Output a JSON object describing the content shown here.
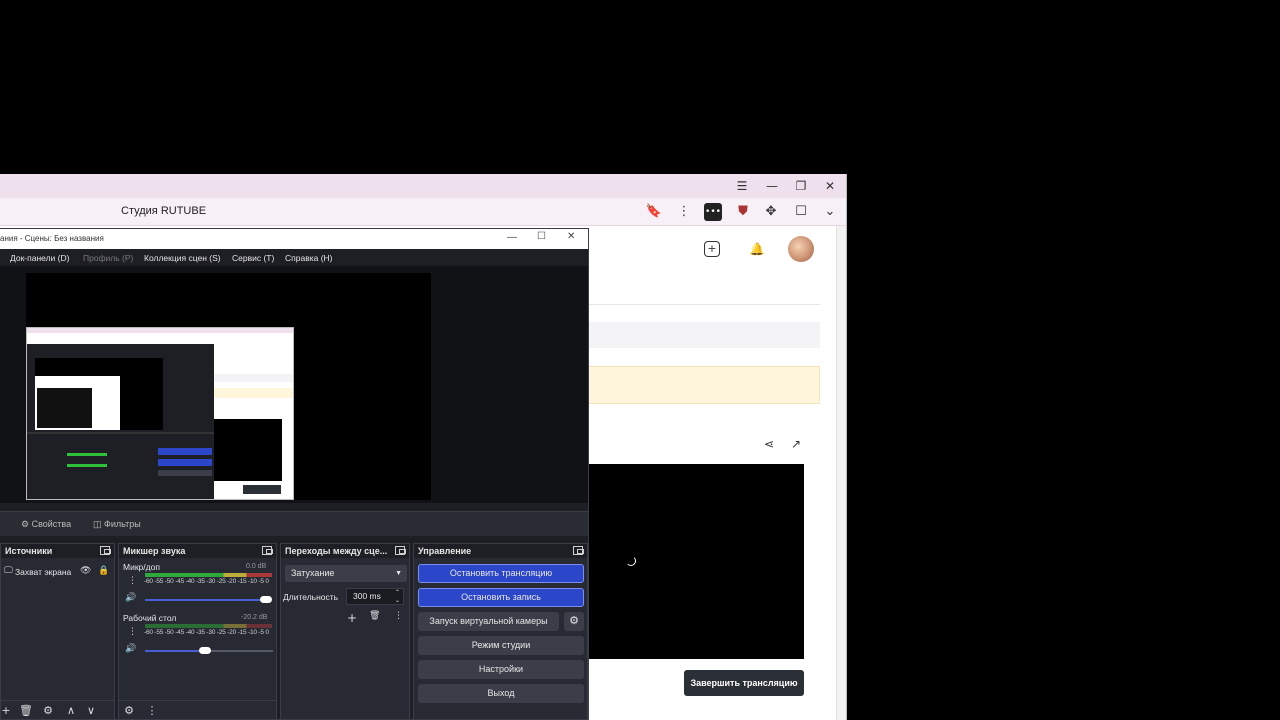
{
  "browser": {
    "title": "Студия RUTUBE",
    "controls": {
      "menu": "☰",
      "minimize": "—",
      "restore": "❐",
      "close": "✕"
    },
    "toolbar_icons": [
      "bookmark-icon",
      "more-vert-icon",
      "extension-dots-icon",
      "shield-icon",
      "puzzle-icon",
      "panel-icon",
      "chevron-down-icon"
    ]
  },
  "rutube": {
    "header_icons": [
      "add-video-icon",
      "bell-icon"
    ],
    "end_stream_label": "Завершить трансляцию",
    "accent_warn": "#fff6db"
  },
  "obs": {
    "title": "ания - Сцены: Без названия",
    "menu": [
      {
        "label": "Док-панели (D)",
        "disabled": false
      },
      {
        "label": "Профиль (P)",
        "disabled": true
      },
      {
        "label": "Коллекция сцен (S)",
        "disabled": false
      },
      {
        "label": "Сервис (T)",
        "disabled": false
      },
      {
        "label": "Справка (H)",
        "disabled": false
      }
    ],
    "props_label": "Свойства",
    "filters_label": "Фильтры",
    "sources": {
      "title": "Источники",
      "items": [
        {
          "label": "Захват экрана"
        }
      ]
    },
    "mixer": {
      "title": "Микшер звука",
      "channels": [
        {
          "name": "Микр/доп",
          "db": "0.0 dB",
          "level": 0.62,
          "volume": 1.0
        },
        {
          "name": "Рабочий стол",
          "db": "-20.2 dB",
          "level": 0.45,
          "volume": 0.52
        }
      ],
      "ticks": "-60 -55 -50 -45 -40 -35 -30 -25 -20 -15 -10 -5 0"
    },
    "transitions": {
      "title": "Переходы между сце...",
      "selected": "Затухание",
      "duration_label": "Длительность",
      "duration_value": "300 ms"
    },
    "controls": {
      "title": "Управление",
      "stop_stream": "Остановить трансляцию",
      "stop_record": "Остановить запись",
      "virtual_cam": "Запуск виртуальной камеры",
      "studio_mode": "Режим студии",
      "settings": "Настройки",
      "exit": "Выход"
    },
    "accent": "#2c46c9"
  }
}
